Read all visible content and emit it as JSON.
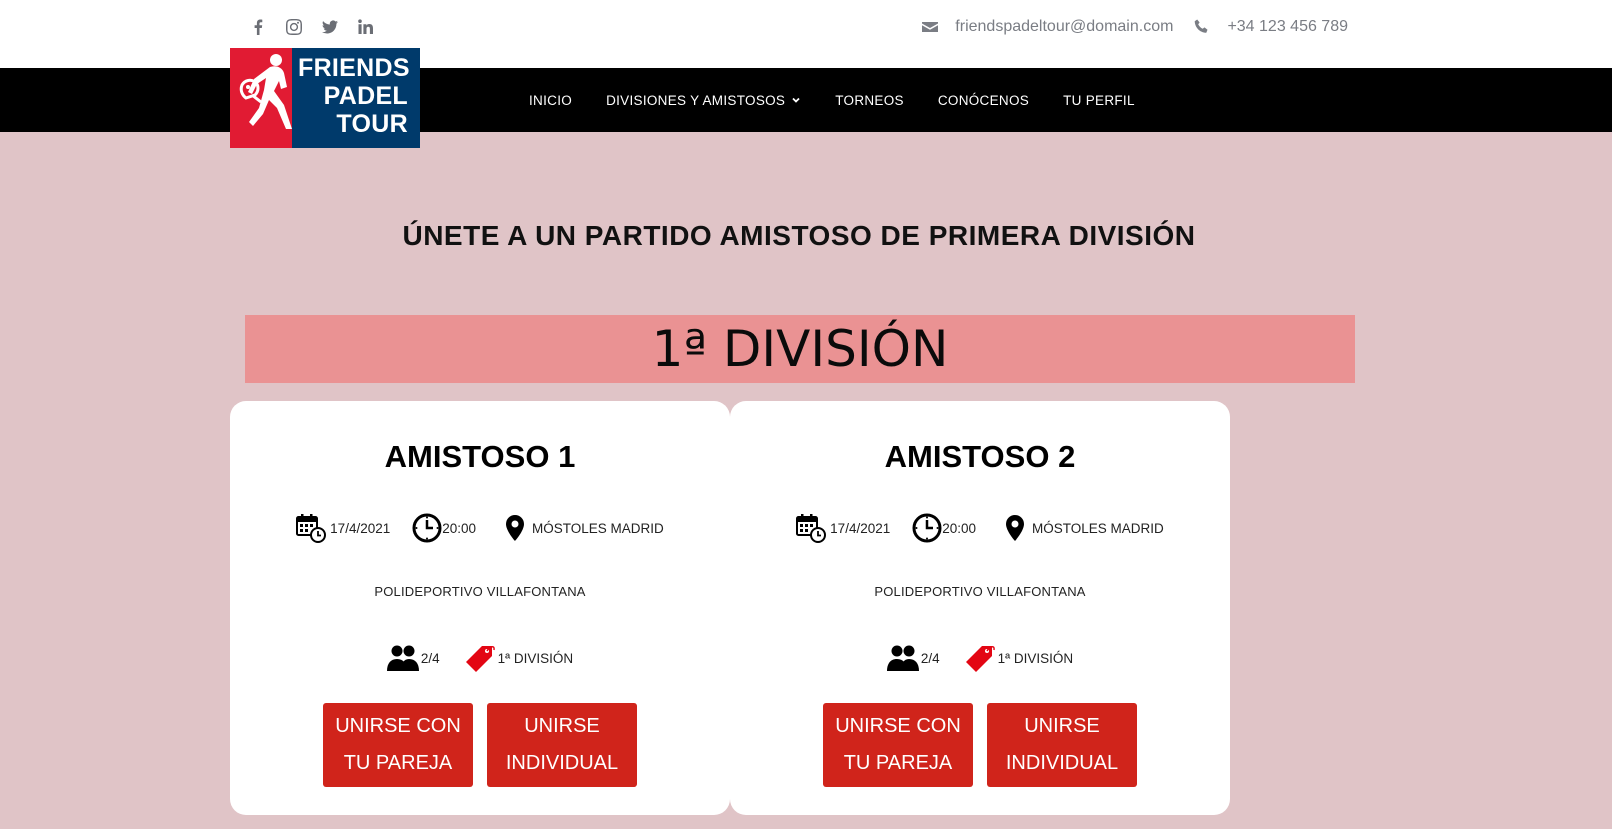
{
  "header": {
    "social_icons": [
      "facebook-icon",
      "instagram-icon",
      "twitter-icon",
      "linkedin-icon"
    ],
    "email": "friendspadeltour@domain.com",
    "phone": "+34 123 456 789"
  },
  "logo": {
    "line1": "FRIENDS",
    "line2": "PADEL",
    "line3": "TOUR"
  },
  "nav": {
    "items": [
      "INICIO",
      "DIVISIONES Y AMISTOSOS",
      "TORNEOS",
      "CONÓCENOS",
      "TU PERFIL"
    ]
  },
  "page": {
    "heading": "ÚNETE A UN PARTIDO AMISTOSO DE PRIMERA DIVISIÓN",
    "division_banner": "1ª DIVISIÓN"
  },
  "cards": [
    {
      "title": "AMISTOSO 1",
      "date": "17/4/2021",
      "time": "20:00",
      "location": "MÓSTOLES MADRID",
      "venue": "POLIDEPORTIVO VILLAFONTANA",
      "players": "2/4",
      "division": "1ª DIVISIÓN",
      "btn_pair_l1": "UNIRSE CON",
      "btn_pair_l2": "TU PAREJA",
      "btn_ind_l1": "UNIRSE",
      "btn_ind_l2": "INDIVIDUAL"
    },
    {
      "title": "AMISTOSO 2",
      "date": "17/4/2021",
      "time": "20:00",
      "location": "MÓSTOLES MADRID",
      "venue": "POLIDEPORTIVO VILLAFONTANA",
      "players": "2/4",
      "division": "1ª DIVISIÓN",
      "btn_pair_l1": "UNIRSE CON",
      "btn_pair_l2": "TU PAREJA",
      "btn_ind_l1": "UNIRSE",
      "btn_ind_l2": "INDIVIDUAL"
    }
  ],
  "colors": {
    "page_bg": "#e0c4c7",
    "navbar_bg": "#000000",
    "banner_bg": "#ea9293",
    "button_bg": "#d0241b",
    "logo_red": "#e11b33",
    "logo_blue": "#003a6b",
    "tag_red": "#e30613"
  }
}
